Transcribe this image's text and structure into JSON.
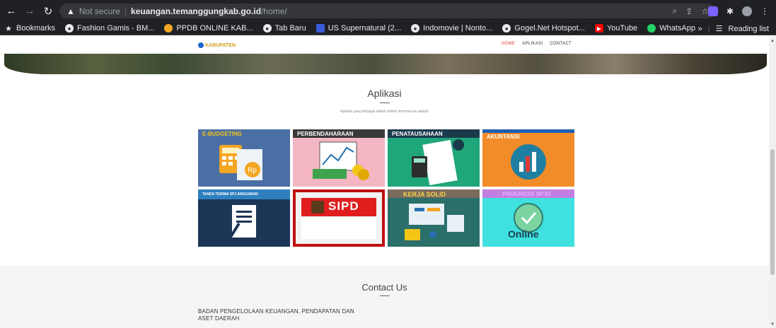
{
  "browser": {
    "not_secure": "Not secure",
    "url_host": "keuangan.temanggungkab.go.id",
    "url_path": "/home/",
    "bookmarks": [
      {
        "label": "Bookmarks",
        "icon": "star-icon"
      },
      {
        "label": "Fashion Gamis - BM...",
        "icon": "globe-icon"
      },
      {
        "label": "PPDB ONLINE KAB...",
        "icon": "ppdb-icon"
      },
      {
        "label": "Tab Baru",
        "icon": "globe-icon"
      },
      {
        "label": "US Supernatural (2...",
        "icon": "tv-icon"
      },
      {
        "label": "Indomovie | Nonto...",
        "icon": "globe-icon"
      },
      {
        "label": "Gogel.Net Hotspot...",
        "icon": "globe-icon"
      },
      {
        "label": "YouTube",
        "icon": "youtube-icon"
      },
      {
        "label": "WhatsApp",
        "icon": "whatsapp-icon"
      }
    ],
    "reading_list": "Reading list",
    "more": "»"
  },
  "nav": {
    "logo_text": "KABUPATEN",
    "items": [
      {
        "label": "HOME",
        "active": true
      },
      {
        "label": "APLIKASI",
        "active": false
      },
      {
        "label": "CONTACT",
        "active": false
      }
    ]
  },
  "aplikasi": {
    "title": "Aplikasi",
    "subtitle": "Aplikasi yang terdapat dalam sistem informasi ini adalah",
    "tiles": [
      {
        "label": "E-BUDGETING",
        "bg": "#4a6fa5",
        "label_color": "#f0c419"
      },
      {
        "label": "PERBENDAHARAAN",
        "bg": "#f4b6c2",
        "label_color": "#ffffff"
      },
      {
        "label": "PENATAUSAHAAN",
        "bg": "#1fa67a",
        "label_color": "#ffffff"
      },
      {
        "label": "AKUNTANSI",
        "bg": "#f28c28",
        "label_color": "#ffffff"
      },
      {
        "label": "TANDA TERIMA SPJ ANGGARAN",
        "bg": "#1d3557",
        "label_color": "#ffffff"
      },
      {
        "label": "SIPD",
        "bg": "#e01e1e",
        "label_color": "#ffffff"
      },
      {
        "label": "KERJA SOLID",
        "bg": "#2a6f6a",
        "label_color": "#f7d54a"
      },
      {
        "label": "PROGRESS SPJD",
        "bg": "#3ee0e0",
        "label_color": "#b45bd6"
      }
    ],
    "online_text": "Online"
  },
  "contact": {
    "title": "Contact Us",
    "address_line1": "BADAN PENGELOLAAN KEUANGAN, PENDAPATAN DAN",
    "address_line2": "ASET DAERAH"
  }
}
